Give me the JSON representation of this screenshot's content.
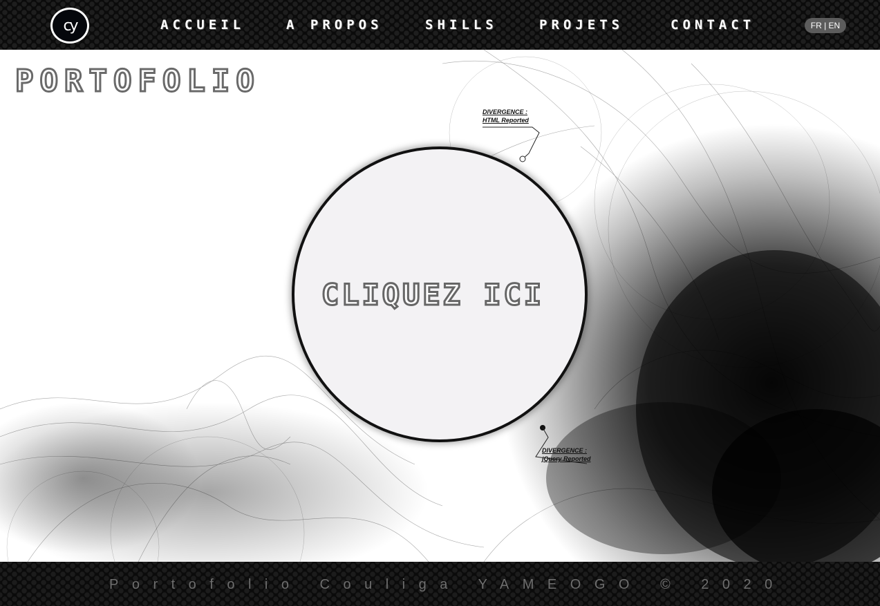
{
  "header": {
    "logo_text": "cy",
    "nav": [
      {
        "label": "ACCUEIL"
      },
      {
        "label": "A PROPOS"
      },
      {
        "label": "SHILLS"
      },
      {
        "label": "PROJETS"
      },
      {
        "label": "CONTACT"
      }
    ],
    "lang_switch": "FR | EN"
  },
  "main": {
    "title": "PORTOFOLIO",
    "cta_label": "CLIQUEZ ICI",
    "callouts": [
      {
        "line1": "DIVERGENCE :",
        "line2": "HTML Reported"
      },
      {
        "line1": "DIVERGENCE :",
        "line2": "jQuery Reported"
      }
    ]
  },
  "footer": {
    "text": "Portofolio Couliga YAMEOGO © 2020"
  },
  "colors": {
    "bar_bg": "#0b0b0b",
    "lang_pill": "#5c5c5c",
    "outline_text": "#6a6a6a",
    "footer_text": "#6e6e6e"
  }
}
